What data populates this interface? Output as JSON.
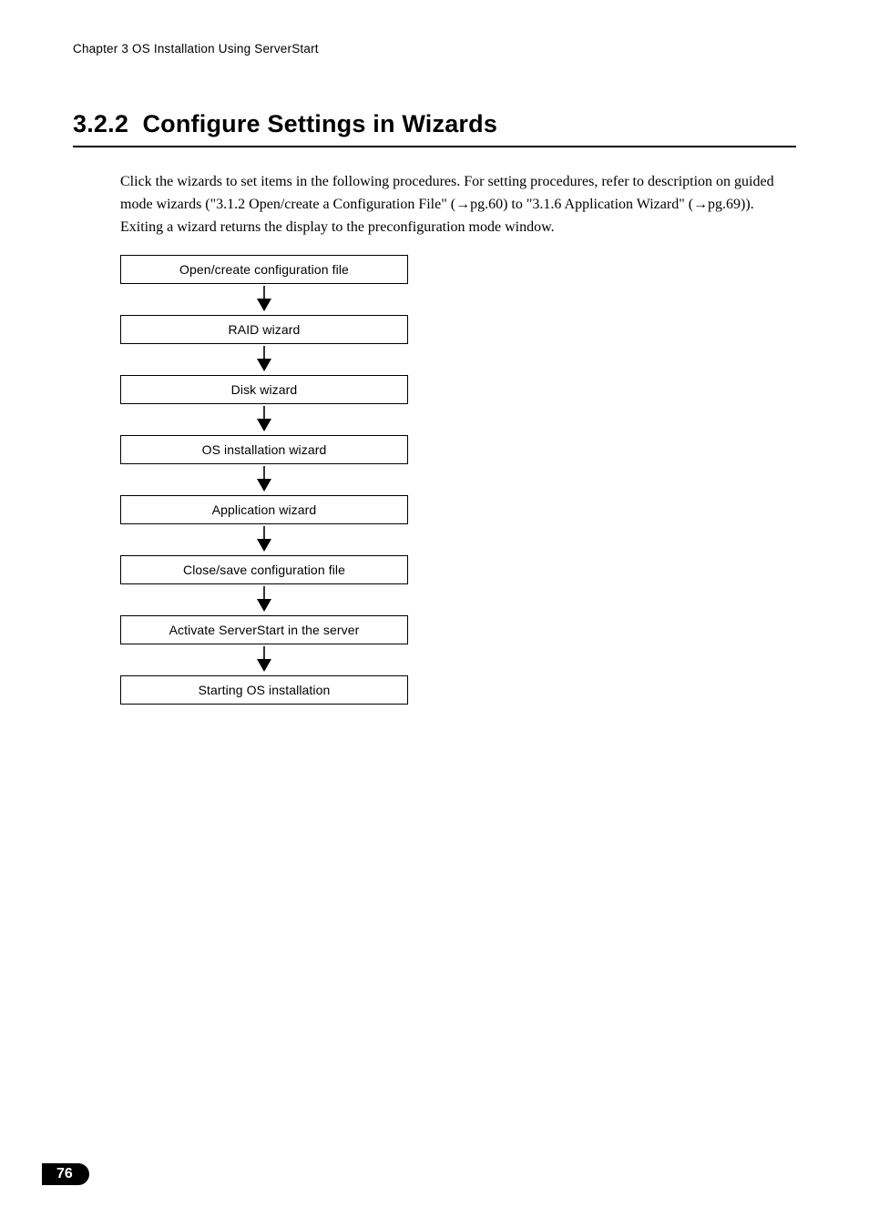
{
  "header": {
    "chapter_line": "Chapter 3  OS Installation Using ServerStart"
  },
  "section": {
    "number": "3.2.2",
    "title": "Configure Settings in Wizards"
  },
  "body": {
    "p1_a": "Click the wizards to set items in the following procedures. For setting procedures, refer to description on guided mode wizards (",
    "p1_link1": "\"3.1.2 Open/create a Configuration File\" (→pg.60)",
    "p1_mid": " to ",
    "p1_link2": "\"3.1.6 Application Wizard\" (→pg.69)",
    "p1_end": ").",
    "p2": " Exiting a wizard returns the display to the preconfiguration mode window."
  },
  "flow": {
    "steps": [
      "Open/create configuration file",
      "RAID wizard",
      "Disk wizard",
      "OS installation wizard",
      "Application wizard",
      "Close/save configuration file",
      "Activate ServerStart in the server",
      "Starting OS installation"
    ]
  },
  "footer": {
    "page_number": "76"
  }
}
